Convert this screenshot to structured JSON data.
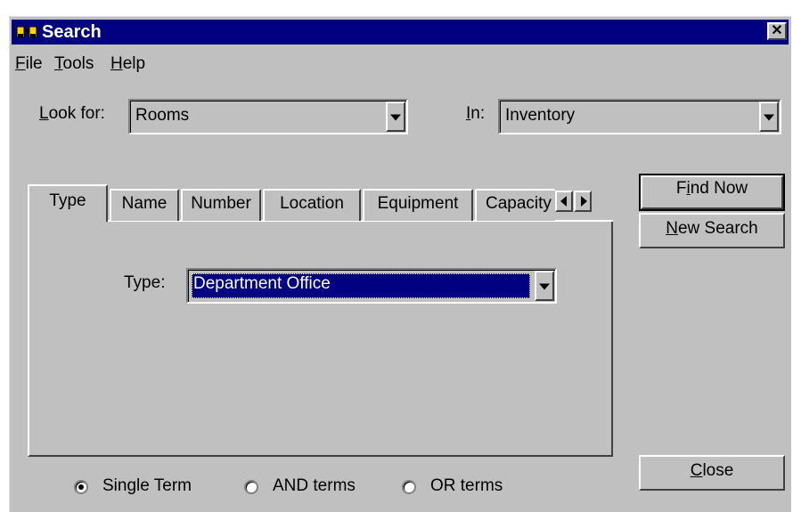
{
  "window": {
    "title": "Search",
    "close_glyph": "✕",
    "icon": "binoculars-icon"
  },
  "menu": {
    "file": {
      "mnemonic": "F",
      "rest": "ile"
    },
    "tools": {
      "mnemonic": "T",
      "rest": "ools"
    },
    "help": {
      "mnemonic": "H",
      "rest": "elp"
    }
  },
  "look_for": {
    "label_mnemonic": "L",
    "label_rest": "ook for:",
    "value": "Rooms"
  },
  "in": {
    "label_mnemonic": "I",
    "label_rest": "n:",
    "value": "Inventory"
  },
  "tabs": [
    {
      "label": "Type",
      "active": true
    },
    {
      "label": "Name"
    },
    {
      "label": "Number"
    },
    {
      "label": "Location"
    },
    {
      "label": "Equipment"
    },
    {
      "label": "Capacity"
    }
  ],
  "type_panel": {
    "label": "Type:",
    "value": "Department Office"
  },
  "buttons": {
    "find_now": {
      "pre": "F",
      "mnemonic": "i",
      "post": "nd Now"
    },
    "new_search": {
      "mnemonic": "N",
      "rest": "ew Search"
    },
    "close": {
      "mnemonic": "C",
      "rest": "lose"
    }
  },
  "search_mode": {
    "selected": "Single Term",
    "options": [
      "Single Term",
      "AND terms",
      "OR terms"
    ]
  },
  "colors": {
    "face": "#c0c0c0",
    "titlebar": "#000080",
    "selection": "#000080"
  }
}
